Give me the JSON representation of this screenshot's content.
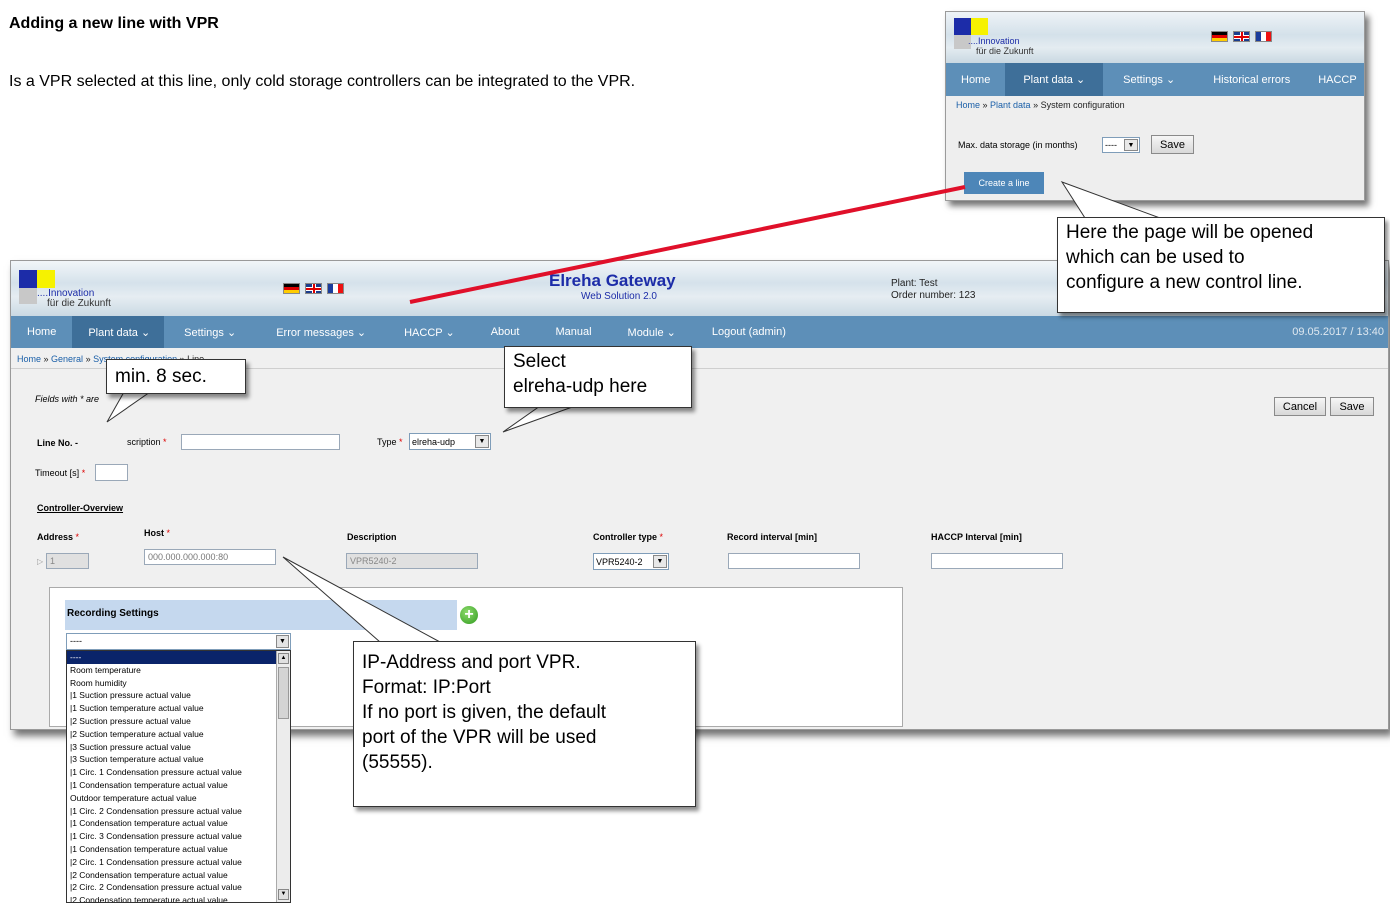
{
  "doc": {
    "heading": "Adding a new line with VPR",
    "paragraph": "Is a VPR selected at this line, only cold storage controllers can be integrated to the VPR."
  },
  "logo": {
    "line1": "....Innovation",
    "line2": "für die Zukunft"
  },
  "mini": {
    "nav": [
      "Home",
      "Plant data ⌄",
      "Settings ⌄",
      "Historical errors",
      "HACCP"
    ],
    "breadcrumb": {
      "home": "Home",
      "sep": " » ",
      "plant": "Plant data",
      "current": "System configuration"
    },
    "storage_label": "Max. data storage (in months)",
    "storage_value": "----",
    "save_label": "Save",
    "create_line_label": "Create a line"
  },
  "main": {
    "app_title": "Elreha Gateway",
    "app_subtitle": "Web Solution 2.0",
    "plant_line": "Plant: Test",
    "order_line": "Order number: 123",
    "nav": [
      "Home",
      "Plant data ⌄",
      "Settings ⌄",
      "Error messages ⌄",
      "HACCP ⌄",
      "About",
      "Manual",
      "Module ⌄",
      "Logout (admin)"
    ],
    "datetime": "09.05.2017 / 13:40",
    "breadcrumb": {
      "home": "Home",
      "general": "General",
      "sysconf": "System configuration",
      "current": "Line"
    },
    "required_note": "Fields with * are",
    "cancel_label": "Cancel",
    "save_label": "Save",
    "line_no_label": "Line No. -",
    "description_label": "scription",
    "type_label": "Type",
    "type_value": "elreha-udp",
    "timeout_label": "Timeout [s]",
    "overview_title": "Controller-Overview",
    "columns": {
      "address": "Address",
      "host": "Host",
      "description": "Description",
      "controller_type": "Controller type",
      "record_interval": "Record interval [min]",
      "haccp_interval": "HACCP Interval [min]"
    },
    "row": {
      "address": "1",
      "host": "000.000.000.000:80",
      "description": "VPR5240-2",
      "controller_type": "VPR5240-2"
    },
    "recording_title": "Recording Settings",
    "dropdown_value": "----",
    "dropdown_options": [
      "----",
      "Room temperature",
      "Room humidity",
      "|1 Suction pressure actual value",
      "|1 Suction temperature actual value",
      "|2 Suction pressure actual value",
      "|2 Suction temperature actual value",
      "|3 Suction pressure actual value",
      "|3 Suction temperature actual value",
      "|1 Circ. 1 Condensation pressure actual value",
      "|1 Condensation temperature actual value",
      "Outdoor temperature actual value",
      "|1 Circ. 2 Condensation pressure actual value",
      "|1 Condensation temperature actual value",
      "|1 Circ. 3 Condensation pressure actual value",
      "|1 Condensation temperature actual value",
      "|2 Circ. 1 Condensation pressure actual value",
      "|2 Condensation temperature actual value",
      "|2 Circ. 2 Condensation pressure actual value",
      "|2 Condensation temperature actual value"
    ]
  },
  "callouts": {
    "create_page": [
      "Here the page will be opened",
      "which can be used to",
      "configure a new control line."
    ],
    "min_timeout": "min. 8 sec.",
    "select_udp": [
      "Select",
      "elreha-udp here"
    ],
    "ip_address": [
      "IP-Address and port VPR.",
      "Format: IP:Port",
      "If no port is given, the default",
      "port of the VPR will be used",
      "(55555)."
    ]
  },
  "colors": {
    "nav_bg": "#5d8fb8",
    "nav_active": "#3e6f99",
    "brand_blue": "#1c2ca8",
    "arrow_red": "#e0102a"
  }
}
